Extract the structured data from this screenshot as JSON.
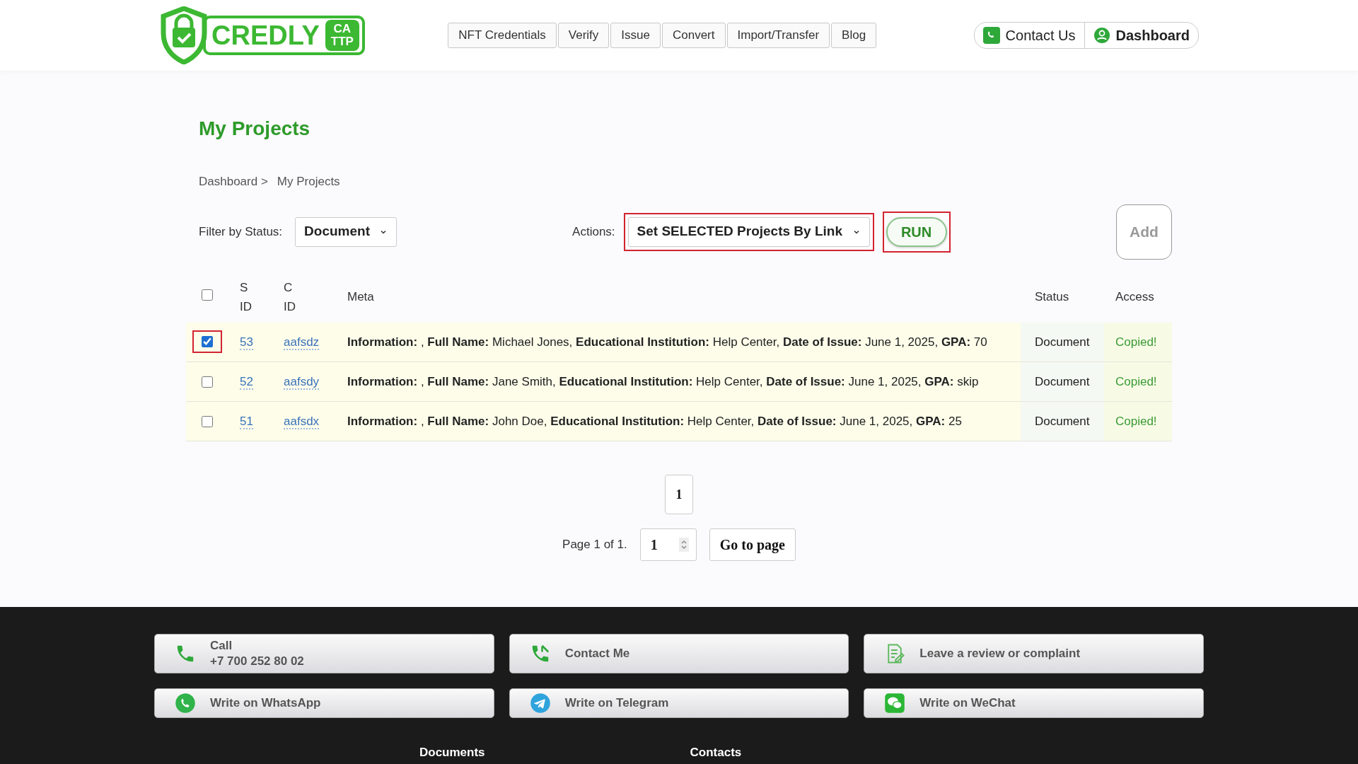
{
  "header": {
    "logo": {
      "word": "CREDLY",
      "badge_lines": [
        "CA",
        "TTP"
      ]
    },
    "nav": [
      "NFT Credentials",
      "Verify",
      "Issue",
      "Convert",
      "Import/Transfer",
      "Blog"
    ],
    "contact": "Contact Us",
    "dashboard": "Dashboard"
  },
  "page": {
    "title": "My Projects",
    "breadcrumb": [
      "Dashboard >",
      "My Projects"
    ]
  },
  "toolbar": {
    "filter_label": "Filter by Status:",
    "filter_value": "Document",
    "actions_label": "Actions:",
    "action_value": "Set SELECTED Projects By Link",
    "action_highlighted": true,
    "run": "RUN",
    "run_highlighted": true,
    "add": "Add"
  },
  "table": {
    "header_checked": false,
    "columns": [
      [
        "S",
        "ID"
      ],
      [
        "C",
        "ID"
      ],
      [
        "Meta"
      ],
      [
        "Status"
      ],
      [
        "Access"
      ]
    ],
    "rows": [
      {
        "checked": true,
        "highlighted": true,
        "sid": "53",
        "cid": "aafsdz",
        "meta": "**Information:** , **Full Name:** Michael Jones, **Educational Institution:** Help Center, **Date of Issue:** June 1, 2025, **GPA:** 70",
        "status": "Document",
        "access": "Copied!"
      },
      {
        "checked": false,
        "highlighted": false,
        "sid": "52",
        "cid": "aafsdy",
        "meta": "**Information:** , **Full Name:** Jane Smith, **Educational Institution:** Help Center, **Date of Issue:** June 1, 2025, **GPA:** skip",
        "status": "Document",
        "access": "Copied!"
      },
      {
        "checked": false,
        "highlighted": false,
        "sid": "51",
        "cid": "aafsdx",
        "meta": "**Information:** , **Full Name:** John Doe, **Educational Institution:** Help Center, **Date of Issue:** June 1, 2025, **GPA:** 25",
        "status": "Document",
        "access": "Copied!"
      }
    ]
  },
  "pagination": {
    "pages": [
      {
        "label": "1",
        "selected": true
      }
    ],
    "summary": "Page 1 of 1.",
    "page_input": "1",
    "go": "Go to page"
  },
  "footer": {
    "buttons": [
      {
        "kind": "phone",
        "lines": [
          "Call",
          "+7 700 252 80 02"
        ]
      },
      {
        "kind": "phone-arrow",
        "lines": [
          "Contact Me"
        ]
      },
      {
        "kind": "review",
        "lines": [
          "Leave a review or complaint"
        ]
      },
      {
        "kind": "whatsapp",
        "lines": [
          "Write on WhatsApp"
        ]
      },
      {
        "kind": "telegram",
        "lines": [
          "Write on Telegram"
        ]
      },
      {
        "kind": "wechat",
        "lines": [
          "Write on WeChat"
        ]
      }
    ],
    "headings": [
      "Documents",
      "Contacts"
    ]
  }
}
